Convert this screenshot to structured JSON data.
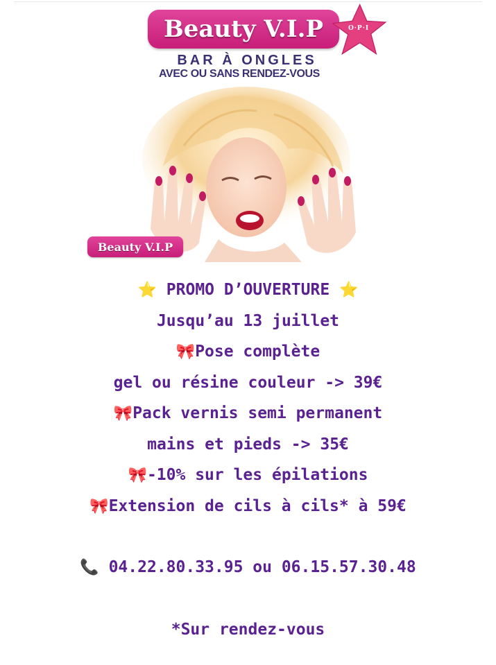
{
  "banner": {
    "logo_text": "Beauty V.I.P",
    "opi_text": "O·P·I",
    "tagline_1": "BAR À ONGLES",
    "tagline_2": "AVEC OU SANS RENDEZ-VOUS",
    "badge_text": "Beauty V.I.P",
    "colors": {
      "brand_pink": "#d22a86",
      "star_pink": "#e4407f",
      "navy": "#3b2f73"
    }
  },
  "promo": {
    "star_icon": "⭐",
    "bow_icon": "🎀",
    "title": "PROMO D’OUVERTURE",
    "until": "Jusqu’au 13 juillet",
    "item_1_line_1": "Pose complète",
    "item_1_line_2": "gel ou résine couleur  -> 39€",
    "item_2_line_1": "Pack vernis semi permanent",
    "item_2_line_2": "mains et pieds -> 35€",
    "item_3": "-10% sur les épilations",
    "item_4": "Extension de cils à cils* à 59€",
    "text_color": "#5a2290"
  },
  "contact": {
    "phone_icon": "📞",
    "phones": "04.22.80.33.95 ou 06.15.57.30.48"
  },
  "footnote": "*Sur rendez-vous"
}
